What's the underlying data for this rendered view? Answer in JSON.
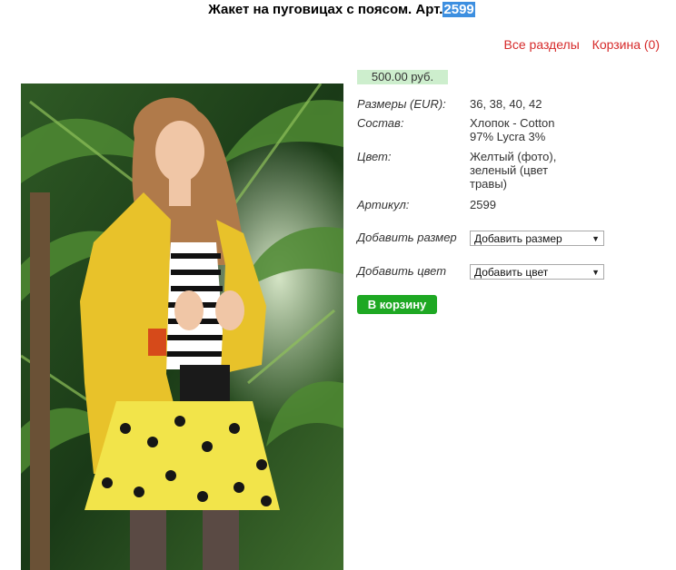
{
  "header": {
    "title_prefix": "Жакет на пуговицах с поясом. Арт.",
    "title_article": "2599"
  },
  "nav": {
    "all_sections": "Все разделы",
    "cart": "Корзина (0)"
  },
  "product": {
    "price": "500.00 руб.",
    "sizes_label": "Размеры (EUR):",
    "sizes_value": "36, 38, 40, 42",
    "composition_label": "Состав:",
    "composition_value": "Хлопок - Cotton 97% Lycra 3%",
    "color_label": "Цвет:",
    "color_value": "Желтый (фото), зеленый (цвет травы)",
    "article_label": "Артикул:",
    "article_value": "2599",
    "add_size_label": "Добавить размер",
    "add_size_selected": "Добавить размер",
    "add_color_label": "Добавить цвет",
    "add_color_selected": "Добавить цвет",
    "add_to_cart": "В корзину"
  },
  "colors": {
    "link": "#d62a2a",
    "price_bg": "#cdeecd",
    "button": "#1ea823",
    "highlight": "#3d8fe0"
  }
}
